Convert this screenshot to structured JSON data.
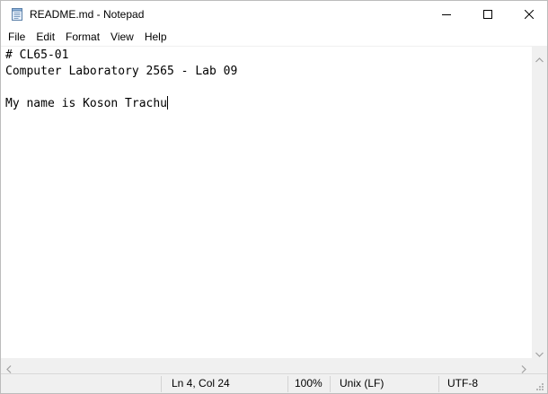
{
  "window": {
    "title": "README.md - Notepad",
    "app_icon": "notepad-icon",
    "controls": {
      "minimize_icon": "minimize-icon",
      "maximize_icon": "maximize-icon",
      "close_icon": "close-icon"
    }
  },
  "menu": {
    "items": [
      {
        "label": "File"
      },
      {
        "label": "Edit"
      },
      {
        "label": "Format"
      },
      {
        "label": "View"
      },
      {
        "label": "Help"
      }
    ]
  },
  "editor": {
    "lines": [
      "# CL65-01",
      "Computer Laboratory 2565 - Lab 09",
      "",
      "My name is Koson Trachu"
    ]
  },
  "statusbar": {
    "position": "Ln 4, Col 24",
    "zoom": "100%",
    "line_ending": "Unix (LF)",
    "encoding": "UTF-8"
  },
  "colors": {
    "chrome_background": "#f0f0f0",
    "text": "#000000",
    "editor_background": "#ffffff"
  }
}
